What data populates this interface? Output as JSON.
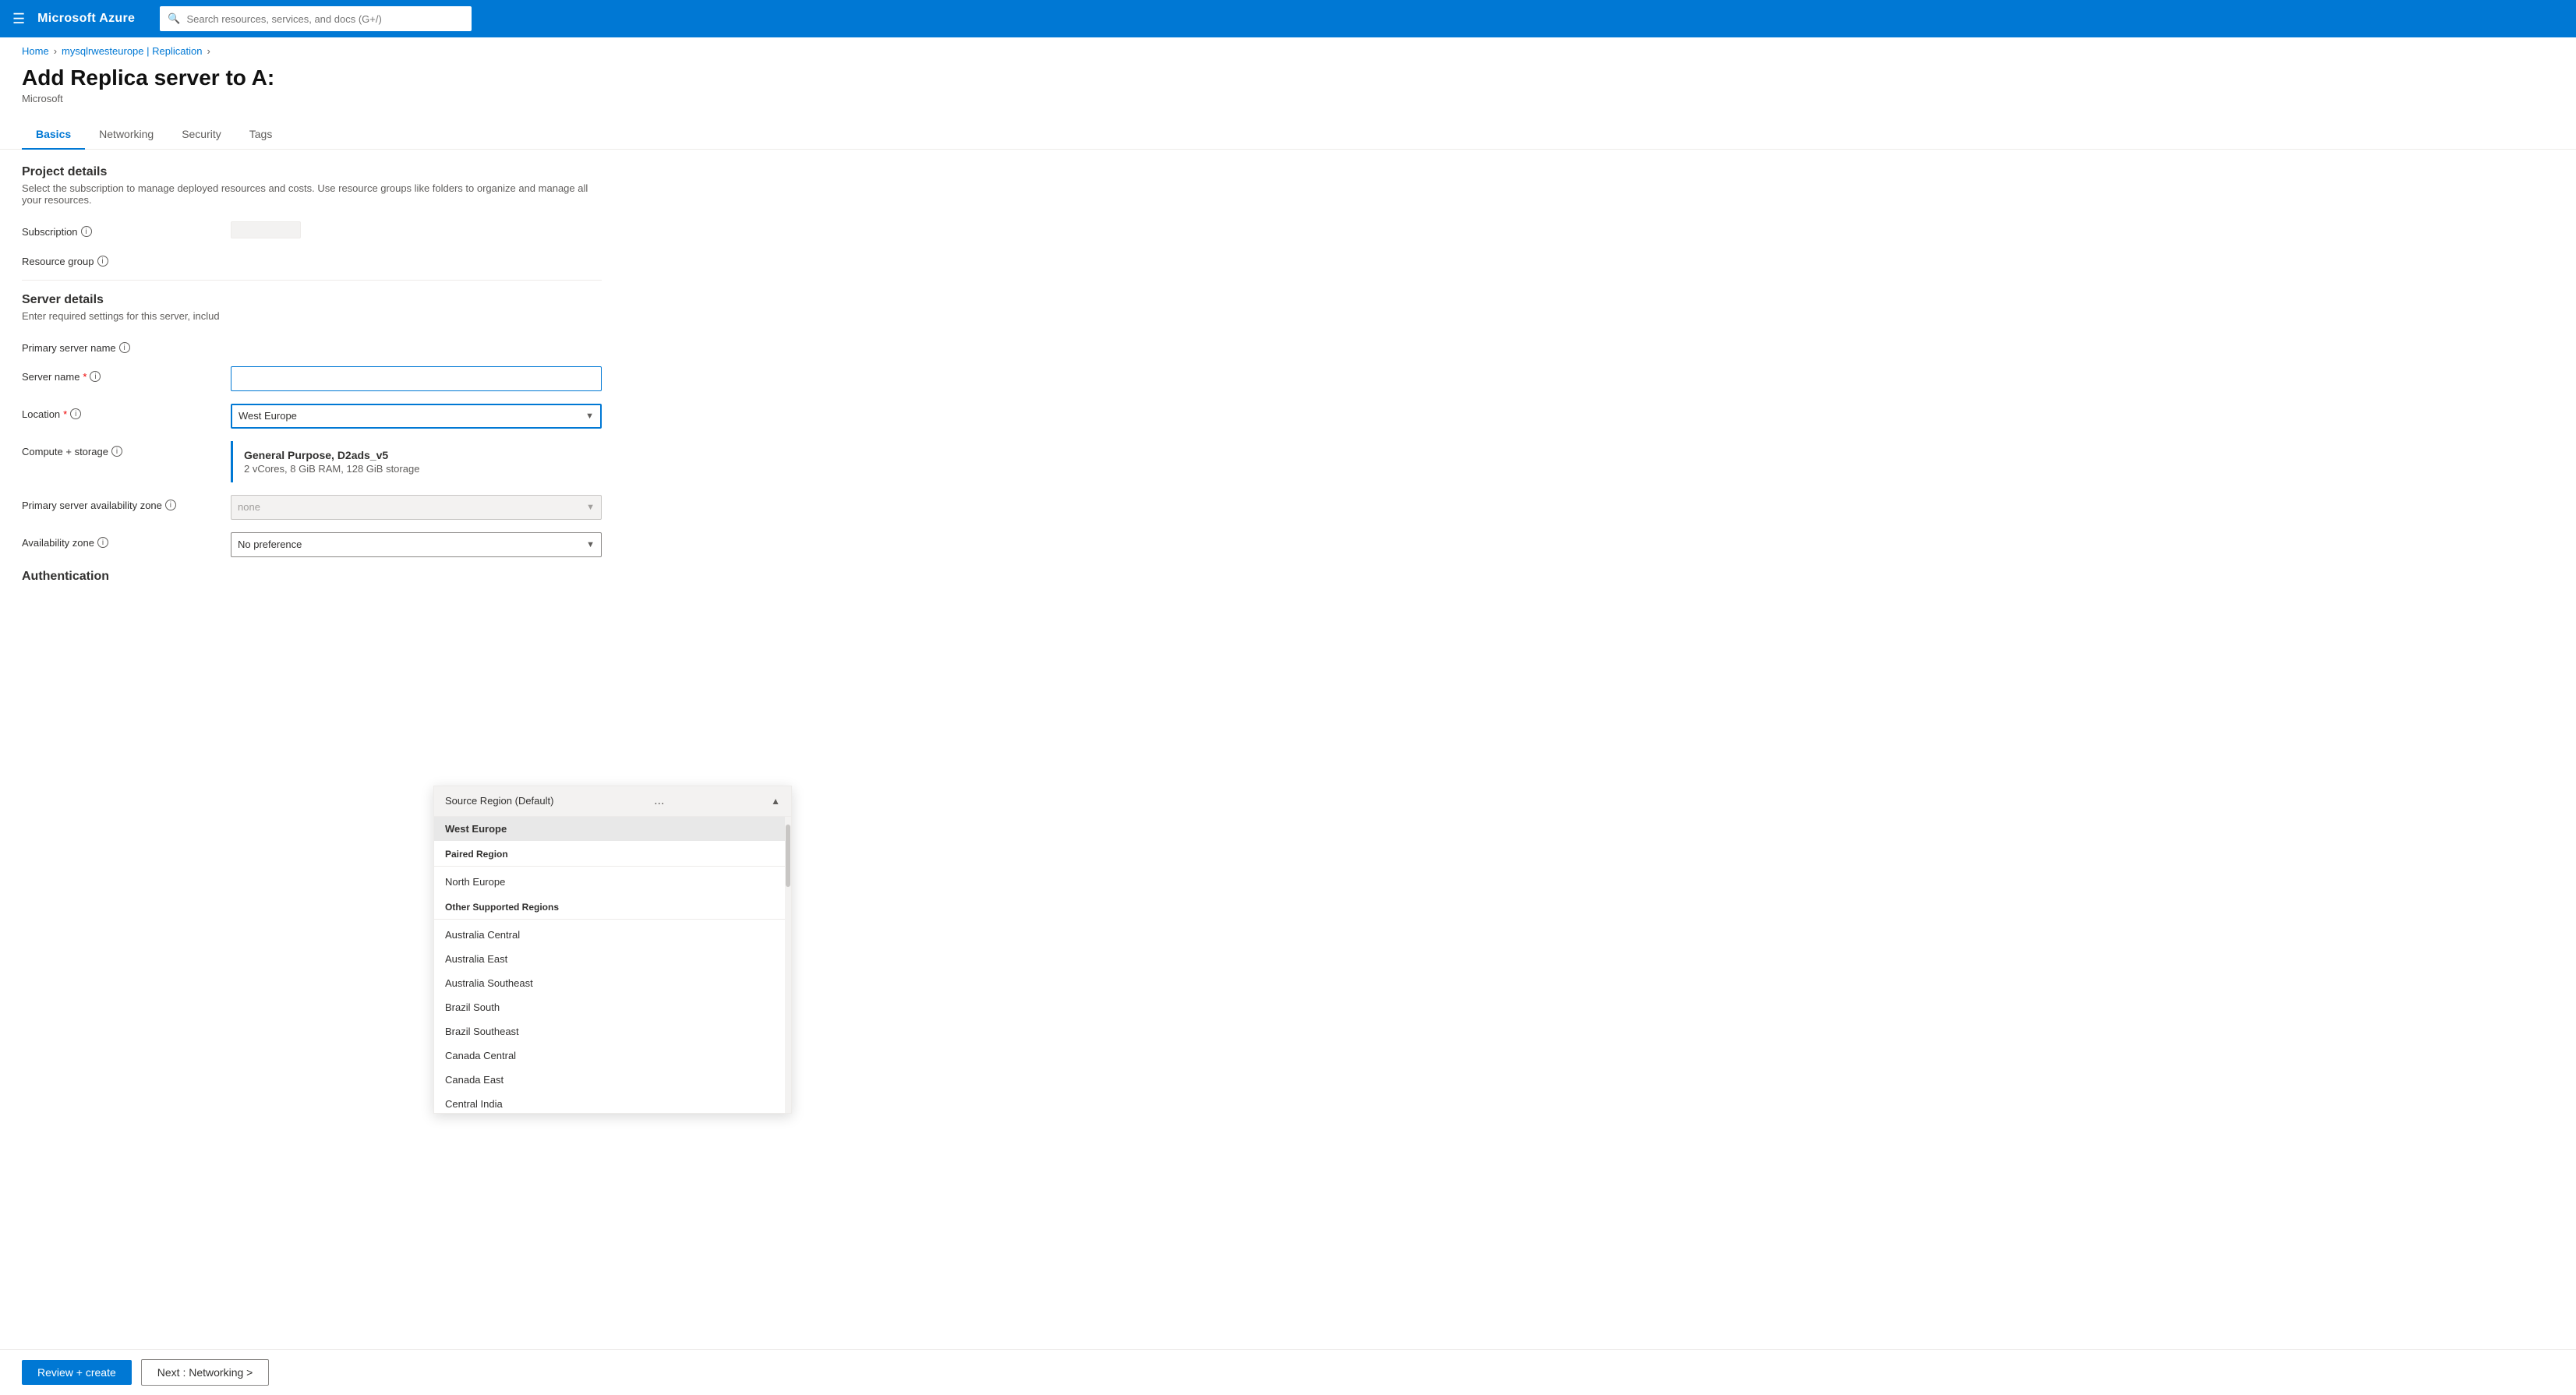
{
  "topNav": {
    "brand": "Microsoft Azure",
    "searchPlaceholder": "Search resources, services, and docs (G+/)"
  },
  "breadcrumb": {
    "items": [
      "Home",
      "mysqlrwesteurope | Replication"
    ]
  },
  "pageTitle": "Add Replica server to A:",
  "pageSubtitle": "Microsoft",
  "tabs": [
    {
      "id": "basics",
      "label": "Basics",
      "active": true
    },
    {
      "id": "networking",
      "label": "Networking",
      "active": false
    },
    {
      "id": "security",
      "label": "Security",
      "active": false
    },
    {
      "id": "tags",
      "label": "Tags",
      "active": false
    }
  ],
  "projectDetails": {
    "title": "Project details",
    "description": "Select the subscription to manage deployed resources and costs. Use resource groups like folders to organize and manage all your resources.",
    "subscriptionLabel": "Subscription",
    "resourceGroupLabel": "Resource group"
  },
  "serverDetails": {
    "title": "Server details",
    "description": "Enter required settings for this server, includ",
    "primaryServerNameLabel": "Primary server name",
    "primaryServerNameValue": "",
    "serverNameLabel": "Server name",
    "serverNameRequired": true,
    "serverNameValue": "",
    "locationLabel": "Location",
    "locationRequired": true,
    "locationValue": "West Europe",
    "computeStorageLabel": "Compute + storage",
    "computeTitle": "General Purpose, D2ads_v5",
    "computeDesc": "2 vCores, 8 GiB RAM, 128 GiB storage",
    "primaryAvailabilityZoneLabel": "Primary server availability zone",
    "primaryAvailabilityZoneValue": "none",
    "availabilityZoneLabel": "Availability zone",
    "availabilityZoneValue": "No preference"
  },
  "authentication": {
    "title": "Authentication"
  },
  "locationDropdown": {
    "headerTitle": "Source Region (Default)",
    "headerDots": "...",
    "sourceRegionLabel": "",
    "items": [
      {
        "group": null,
        "label": "West Europe",
        "selected": true
      },
      {
        "group": "Paired Region",
        "label": null
      },
      {
        "group": null,
        "label": "North Europe",
        "selected": false
      },
      {
        "group": "Other Supported Regions",
        "label": null
      },
      {
        "group": null,
        "label": "Australia Central",
        "selected": false
      },
      {
        "group": null,
        "label": "Australia East",
        "selected": false
      },
      {
        "group": null,
        "label": "Australia Southeast",
        "selected": false
      },
      {
        "group": null,
        "label": "Brazil South",
        "selected": false
      },
      {
        "group": null,
        "label": "Brazil Southeast",
        "selected": false
      },
      {
        "group": null,
        "label": "Canada Central",
        "selected": false
      },
      {
        "group": null,
        "label": "Canada East",
        "selected": false
      },
      {
        "group": null,
        "label": "Central India",
        "selected": false
      }
    ]
  },
  "bottomBar": {
    "reviewCreateLabel": "Review + create",
    "nextLabel": "Next : Networking >"
  }
}
